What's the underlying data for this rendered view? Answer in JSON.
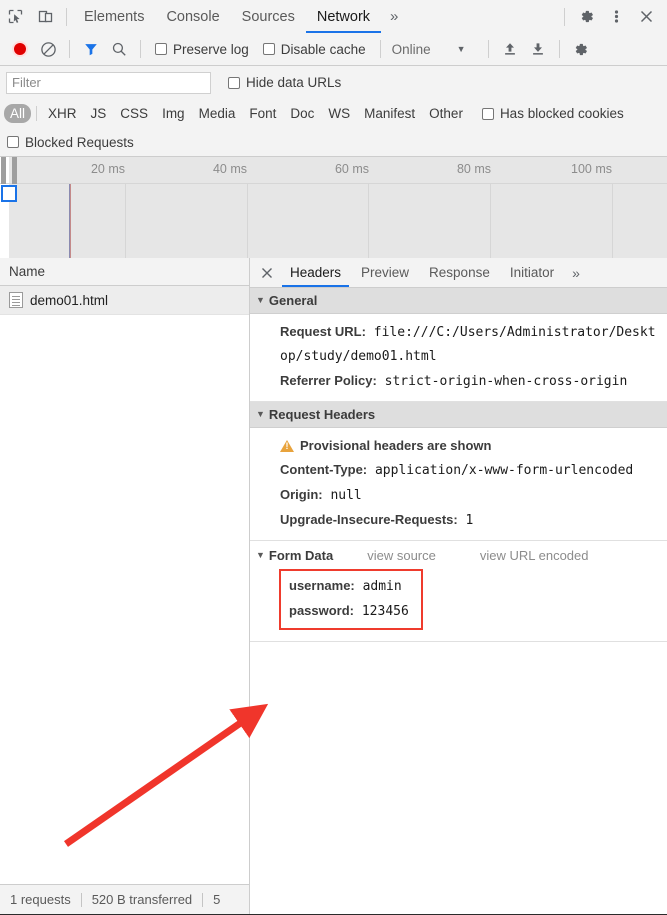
{
  "devtools": {
    "main_tabs": [
      {
        "label": "Elements",
        "active": false
      },
      {
        "label": "Console",
        "active": false
      },
      {
        "label": "Sources",
        "active": false
      },
      {
        "label": "Network",
        "active": true
      }
    ],
    "more_tabs_label": "»",
    "inspect_icon": "inspect-cursor-icon",
    "device_icon": "device-toolbar-icon",
    "settings_icon": "gear-icon",
    "menu_icon": "kebab-menu-icon",
    "close_icon": "close-icon"
  },
  "network_toolbar": {
    "record_icon": "record-button-icon",
    "clear_icon": "clear-icon",
    "filter_icon": "filter-funnel-icon",
    "search_icon": "search-icon",
    "preserve_log": {
      "label": "Preserve log",
      "checked": false
    },
    "disable_cache": {
      "label": "Disable cache",
      "checked": false
    },
    "throttle": {
      "value": "Online",
      "caret": "▼"
    },
    "import_icon": "upload-arrow-icon",
    "export_icon": "download-arrow-icon",
    "settings_icon": "gear-icon"
  },
  "filter_row": {
    "input_value": "",
    "placeholder": "Filter",
    "hide_data_urls": {
      "label": "Hide data URLs",
      "checked": false
    }
  },
  "type_chips": [
    {
      "label": "All",
      "active": true
    },
    {
      "label": "XHR",
      "active": false
    },
    {
      "label": "JS",
      "active": false
    },
    {
      "label": "CSS",
      "active": false
    },
    {
      "label": "Img",
      "active": false
    },
    {
      "label": "Media",
      "active": false
    },
    {
      "label": "Font",
      "active": false
    },
    {
      "label": "Doc",
      "active": false
    },
    {
      "label": "WS",
      "active": false
    },
    {
      "label": "Manifest",
      "active": false
    },
    {
      "label": "Other",
      "active": false
    }
  ],
  "has_blocked_cookies": {
    "label": "Has blocked cookies",
    "checked": false
  },
  "blocked_requests": {
    "label": "Blocked Requests",
    "checked": false
  },
  "timeline": {
    "ticks": [
      "20 ms",
      "40 ms",
      "60 ms",
      "80 ms",
      "100 ms"
    ]
  },
  "request_list": {
    "column_name": "Name",
    "rows": [
      {
        "name": "demo01.html",
        "icon": "document-icon",
        "selected": true
      }
    ]
  },
  "detail_tabs": [
    {
      "label": "Headers",
      "active": true
    },
    {
      "label": "Preview",
      "active": false
    },
    {
      "label": "Response",
      "active": false
    },
    {
      "label": "Initiator",
      "active": false
    }
  ],
  "detail_more_label": "»",
  "sections": {
    "general": {
      "title": "General",
      "triangle": "▼",
      "rows": [
        {
          "key": "Request URL:",
          "value": "file:///C:/Users/Administrator/Desktop/study/demo01.html"
        },
        {
          "key": "Referrer Policy:",
          "value": "strict-origin-when-cross-origin"
        }
      ]
    },
    "request_headers": {
      "title": "Request Headers",
      "triangle": "▼",
      "warning": "Provisional headers are shown",
      "rows": [
        {
          "key": "Content-Type:",
          "value": "application/x-www-form-urlencoded"
        },
        {
          "key": "Origin:",
          "value": "null"
        },
        {
          "key": "Upgrade-Insecure-Requests:",
          "value": "1"
        }
      ]
    },
    "form_data": {
      "title": "Form Data",
      "triangle": "▼",
      "view_source": "view source",
      "view_url_encoded": "view URL encoded",
      "rows": [
        {
          "key": "username:",
          "value": "admin"
        },
        {
          "key": "password:",
          "value": "123456"
        }
      ]
    }
  },
  "status_bar": {
    "requests": "1 requests",
    "transferred": "520 B transferred",
    "resources_clipped": "5"
  },
  "annotation": {
    "arrow_color": "#f0352b",
    "highlight_box_color": "#ef3b2d"
  },
  "colors": {
    "accent": "#1a73e8",
    "toolbar_bg": "#f3f3f3",
    "section_header_bg": "#dedede",
    "record_red": "#e00000",
    "warning_amber": "#e8a33d"
  }
}
